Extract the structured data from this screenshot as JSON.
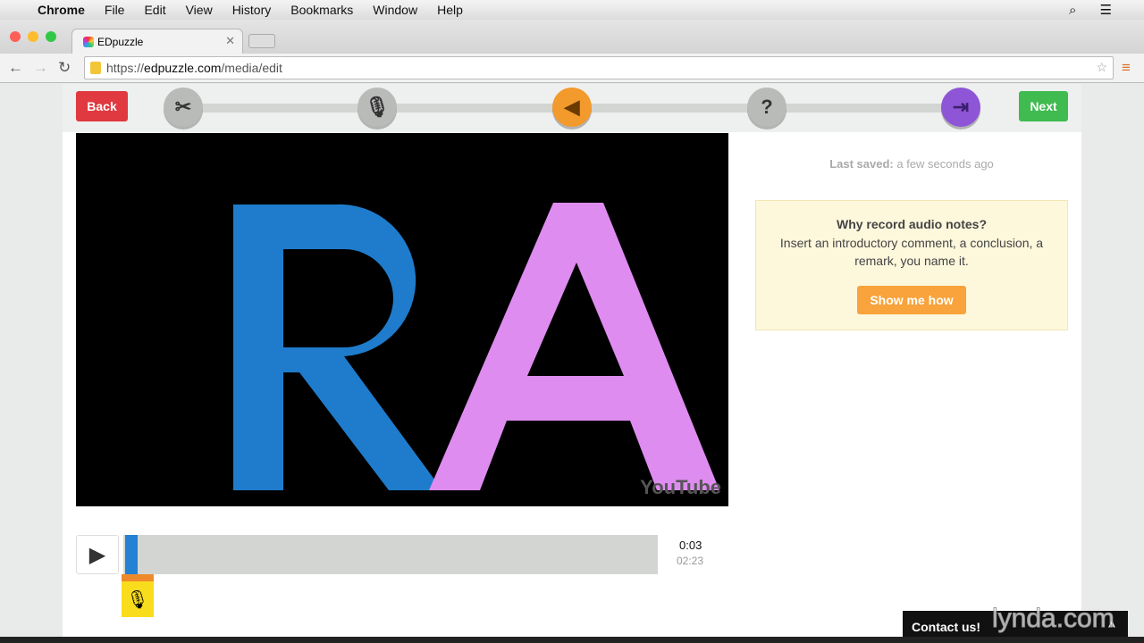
{
  "menubar": {
    "app": "Chrome",
    "items": [
      "File",
      "Edit",
      "View",
      "History",
      "Bookmarks",
      "Window",
      "Help"
    ]
  },
  "browser": {
    "tab_title": "EDpuzzle",
    "url_scheme": "https://",
    "url_host": "edpuzzle.com",
    "url_path": "/media/edit"
  },
  "editor": {
    "back_label": "Back",
    "next_label": "Next",
    "steps": [
      {
        "icon": "scissors-icon",
        "glyph": "✂",
        "color": "#b9bbb9"
      },
      {
        "icon": "microphone-icon",
        "glyph": "🎙",
        "color": "#b9bbb9"
      },
      {
        "icon": "speaker-icon",
        "glyph": "◀",
        "color": "#f39a2c"
      },
      {
        "icon": "question-icon",
        "glyph": "?",
        "color": "#b9bbb9"
      },
      {
        "icon": "exit-icon",
        "glyph": "⇥",
        "color": "#8e56d6"
      }
    ]
  },
  "video": {
    "watermark": "YouTube",
    "logo_letters": "RA",
    "current_time": "0:03",
    "duration": "02:23",
    "progress": 0.021
  },
  "sidebar": {
    "saved_label": "Last saved:",
    "saved_value": "a few seconds ago",
    "tip_title": "Why record audio notes?",
    "tip_text": "Insert an introductory comment, a conclusion, a remark, you name it.",
    "tip_button": "Show me how"
  },
  "footer": {
    "contact": "Contact us!",
    "watermark": "lynda.com"
  }
}
